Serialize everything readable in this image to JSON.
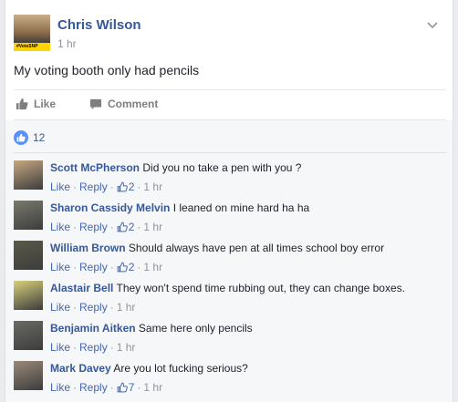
{
  "post": {
    "author": "Chris Wilson",
    "time": "1 hr",
    "badge_text": "#VoteSNP",
    "text": "My voting booth only had pencils"
  },
  "actions": {
    "like_label": "Like",
    "comment_label": "Comment"
  },
  "likes": {
    "count": "12"
  },
  "comment_meta": {
    "like_label": "Like",
    "reply_label": "Reply",
    "separator": "·"
  },
  "comments": [
    {
      "author": "Scott McPherson",
      "text": "Did you no take a pen with you ?",
      "likes": "2",
      "time": "1 hr",
      "avatar_color": "#c8a882"
    },
    {
      "author": "Sharon Cassidy Melvin",
      "text": "I leaned on mine hard ha ha",
      "likes": "2",
      "time": "1 hr",
      "avatar_color": "#7a7a6e"
    },
    {
      "author": "William Brown",
      "text": "Should always have pen at all times school boy error",
      "likes": "2",
      "time": "1 hr",
      "avatar_color": "#5a5a4a"
    },
    {
      "author": "Alastair Bell",
      "text": "They won't spend time rubbing out, they can change boxes.",
      "likes": "",
      "time": "1 hr",
      "avatar_color": "#d8d07a"
    },
    {
      "author": "Benjamin Aitken",
      "text": "Same here only pencils",
      "likes": "",
      "time": "1 hr",
      "avatar_color": "#6a6a66"
    },
    {
      "author": "Mark Davey",
      "text": "Are you lot fucking serious?",
      "likes": "7",
      "time": "1 hr",
      "avatar_color": "#9a8a7a"
    }
  ]
}
